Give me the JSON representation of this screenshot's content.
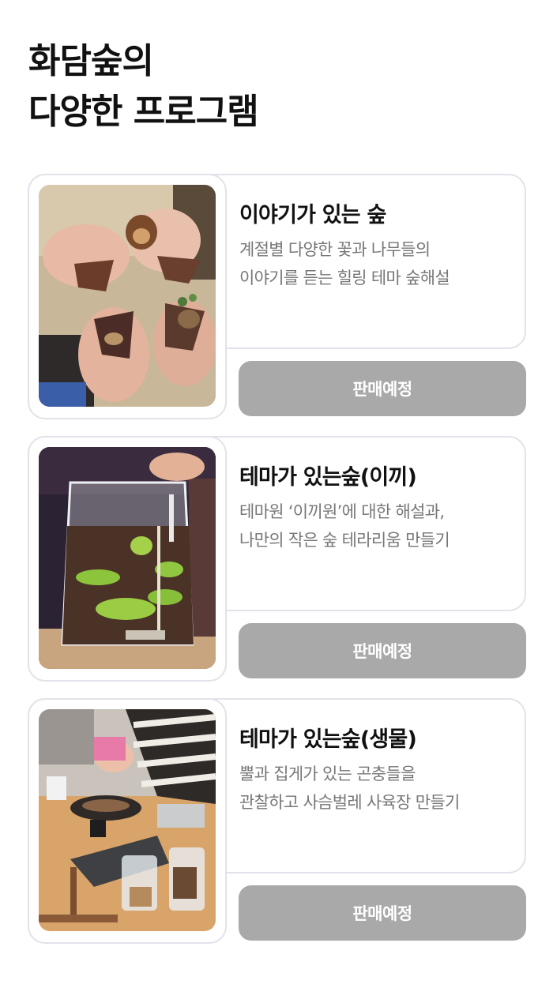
{
  "heading": {
    "line1": "화담숲의",
    "line2": "다양한 프로그램"
  },
  "programs": [
    {
      "title": "이야기가 있는 숲",
      "desc_line1": "계절별 다양한 꽃과 나무들의",
      "desc_line2": "이야기를 듣는 힐링 테마 숲해설",
      "button": "판매예정",
      "photo": "hands-holding-leaves"
    },
    {
      "title": "테마가 있는숲(이끼)",
      "desc_line1": "테마원 ‘이끼원’에 대한 해설과,",
      "desc_line2": "나만의 작은 숲 테라리움 만들기",
      "button": "판매예정",
      "photo": "moss-terrarium-jar"
    },
    {
      "title": "테마가 있는숲(생물)",
      "desc_line1": "뿔과 집게가 있는 곤충들을",
      "desc_line2": "관찰하고 사슴벌레 사육장 만들기",
      "button": "판매예정",
      "photo": "kids-making-beetle-habitat"
    }
  ],
  "colors": {
    "button_bg": "#a9a9a9",
    "card_border": "#e2e2ea",
    "desc_text": "#777777"
  }
}
